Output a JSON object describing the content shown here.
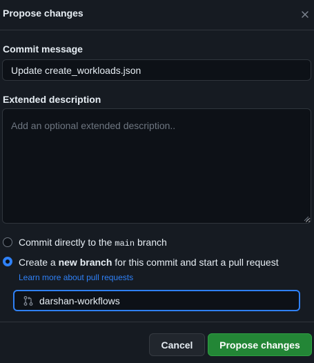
{
  "dialog": {
    "title": "Propose changes"
  },
  "commit": {
    "label": "Commit message",
    "value": "Update create_workloads.json"
  },
  "description": {
    "label": "Extended description",
    "placeholder": "Add an optional extended description.."
  },
  "options": {
    "direct": {
      "prefix": "Commit directly to the ",
      "branch": "main",
      "suffix": " branch",
      "selected": false
    },
    "new_branch": {
      "prefix": "Create a ",
      "emphasis": "new branch",
      "suffix": " for this commit and start a pull request",
      "selected": true
    },
    "learn_more": "Learn more about pull requests"
  },
  "branch": {
    "value": "darshan-workflows"
  },
  "buttons": {
    "cancel": "Cancel",
    "propose": "Propose changes"
  },
  "colors": {
    "background": "#161b22",
    "input_background": "#0d1117",
    "accent": "#2f81f7",
    "primary_button": "#238636",
    "border": "#30363d"
  }
}
